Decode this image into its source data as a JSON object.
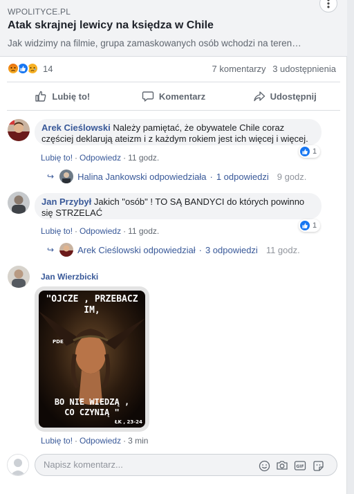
{
  "link_preview": {
    "source": "WPOLITYCE.PL",
    "title": "Atak skrajnej lewicy na księdza w Chile",
    "description": "Jak widzimy na filmie, grupa zamaskowanych osób wchodzi na teren…"
  },
  "stats": {
    "reaction_count": "14",
    "comments": "7 komentarzy",
    "shares": "3 udostępnienia"
  },
  "actions": {
    "like": "Lubię to!",
    "comment": "Komentarz",
    "share": "Udostępnij"
  },
  "comments": [
    {
      "author": "Arek Cieślowski",
      "text_line1": "Należy pamiętać, że obywatele Chile coraz",
      "text_line2": "częściej deklarują ateizm i z każdym rokiem jest ich więcej i więcej.",
      "like": "Lubię to!",
      "reply": "Odpowiedz",
      "time": "11 godz.",
      "reactions": "1",
      "reply_summary": {
        "who": "Halina Jankowski odpowiedziała",
        "count": "1 odpowiedzi",
        "time": "9 godz."
      }
    },
    {
      "author": "Jan Przybył",
      "text_line1": "Jakich \"osób\" ! TO SĄ BANDYCI do których powinno",
      "text_line2": "się STRZELAĆ",
      "like": "Lubię to!",
      "reply": "Odpowiedz",
      "time": "11 godz.",
      "reactions": "1",
      "reply_summary": {
        "who": "Arek Cieślowski odpowiedział",
        "count": "3 odpowiedzi",
        "time": "11 godz."
      }
    },
    {
      "author": "Jan Wierzbicki",
      "like": "Lubię to!",
      "reply": "Odpowiedz",
      "time": "3 min",
      "image_text": {
        "top_line1": "\"OJCZE , PRZEBACZ",
        "top_line2": "IM,",
        "side": "PDE",
        "bottom_line1": "BO NIE WIEDZĄ ,",
        "bottom_line2": "CO CZYNIĄ \"",
        "ref": "ŁK , 23-24"
      }
    }
  ],
  "compose": {
    "placeholder": "Napisz komentarz..."
  },
  "icons": [
    "more-icon",
    "thumb-up-icon",
    "speech-bubble-icon",
    "share-arrow-icon",
    "emoji-icon",
    "camera-icon",
    "gif-icon",
    "sticker-icon"
  ],
  "colors": {
    "link_blue": "#385898",
    "fb_blue": "#1877f2",
    "muted": "#606770",
    "bubble": "#f2f3f5"
  }
}
